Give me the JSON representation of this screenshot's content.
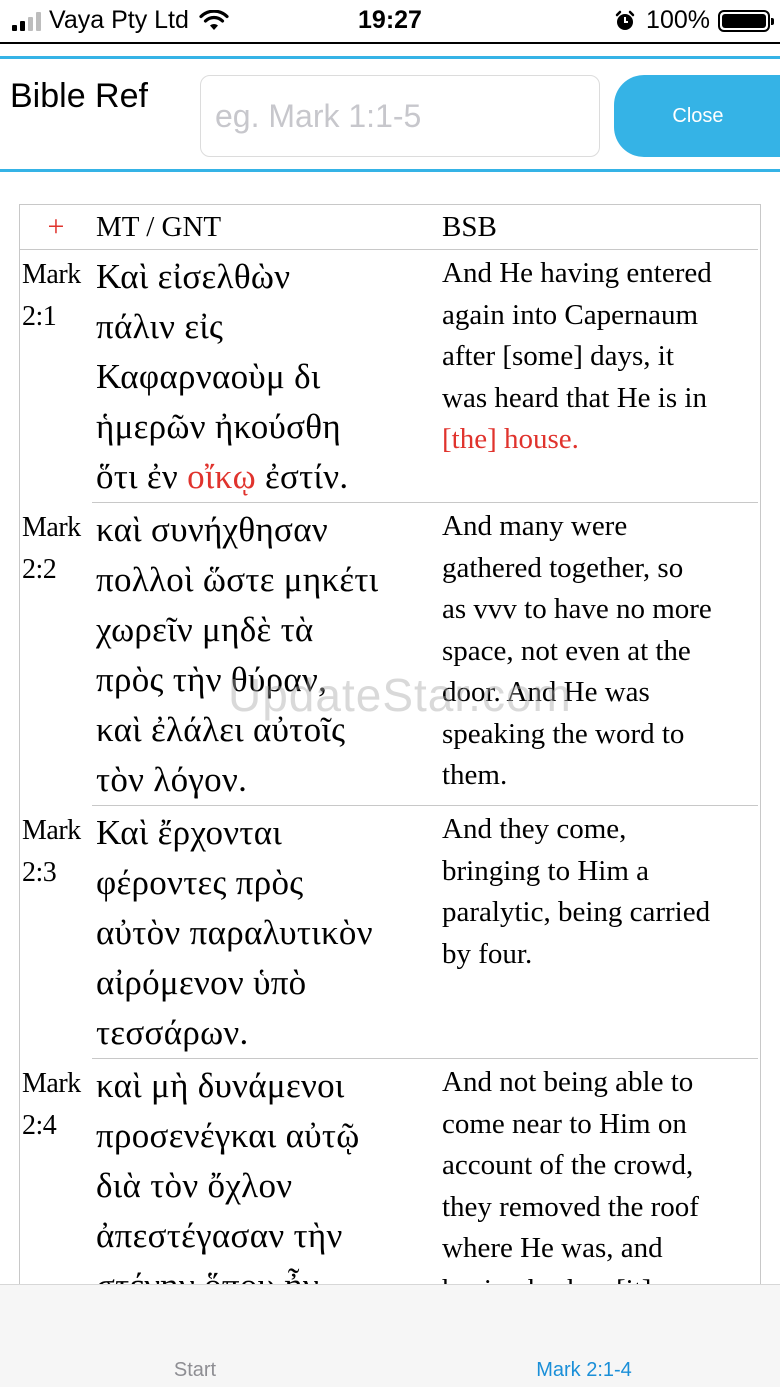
{
  "status_bar": {
    "carrier": "Vaya Pty Ltd",
    "time": "19:27",
    "battery": "100%"
  },
  "header": {
    "title": "Bible Ref",
    "search_placeholder": "eg. Mark 1:1-5",
    "search_value": "",
    "close_label": "Close"
  },
  "table": {
    "headers": {
      "add": "+",
      "greek": "MT / GNT",
      "english": "BSB"
    },
    "rows": [
      {
        "ref": [
          "Mark",
          "2:1"
        ],
        "greek": [
          "Καὶ εἰσελθὼν",
          "πάλιν εἰς",
          "Καφαρναοὺμ δι",
          "ἡμερῶν ἠκούσθη",
          "ὅτι ἐν "
        ],
        "greek_highlight": "οἴκῳ",
        "greek_after": " ἐστίν.",
        "english": [
          "And He having entered",
          "again into Capernaum",
          "after [some] days, it",
          "was heard that He is in"
        ],
        "english_highlight": "[the] house."
      },
      {
        "ref": [
          "Mark",
          "2:2"
        ],
        "greek": [
          "καὶ συνήχθησαν",
          "πολλοὶ ὥστε μηκέτι",
          "χωρεῖν μηδὲ τὰ",
          "πρὸς τὴν θύραν,",
          "καὶ ἐλάλει αὐτοῖς",
          "τὸν λόγον."
        ],
        "english": [
          "And many were",
          "gathered together, so",
          "as vvv to have no more",
          "space, not even at the",
          "door. And He was",
          "speaking the word to",
          "them."
        ]
      },
      {
        "ref": [
          "Mark",
          "2:3"
        ],
        "greek": [
          "Καὶ ἔρχονται",
          "φέροντες πρὸς",
          "αὐτὸν παραλυτικὸν",
          "αἰρόμενον ὑπὸ",
          "τεσσάρων."
        ],
        "english": [
          "And they come,",
          "bringing to Him a",
          "paralytic, being carried",
          "by four."
        ]
      },
      {
        "ref": [
          "Mark",
          "2:4"
        ],
        "greek": [
          "καὶ μὴ δυνάμενοι",
          "προσενέγκαι αὐτῷ",
          "διὰ τὸν ὄχλον",
          "ἀπεστέγασαν τὴν",
          "στέγην ὅπου ἦν,"
        ],
        "english": [
          "And not being able to",
          "come near to Him on",
          "account of the crowd,",
          "they removed the roof",
          "where He was, and",
          "having broken [it] up,"
        ]
      }
    ]
  },
  "watermark": "UpdateStar.com",
  "tab_bar": {
    "start": "Start",
    "current": "Mark 2:1-4"
  },
  "colors": {
    "accent": "#35b3e6",
    "highlight": "#e0332d",
    "tab_active": "#1a8fd8"
  },
  "icons": [
    "signal-icon",
    "wifi-icon",
    "alarm-icon",
    "battery-icon",
    "plus-icon"
  ]
}
